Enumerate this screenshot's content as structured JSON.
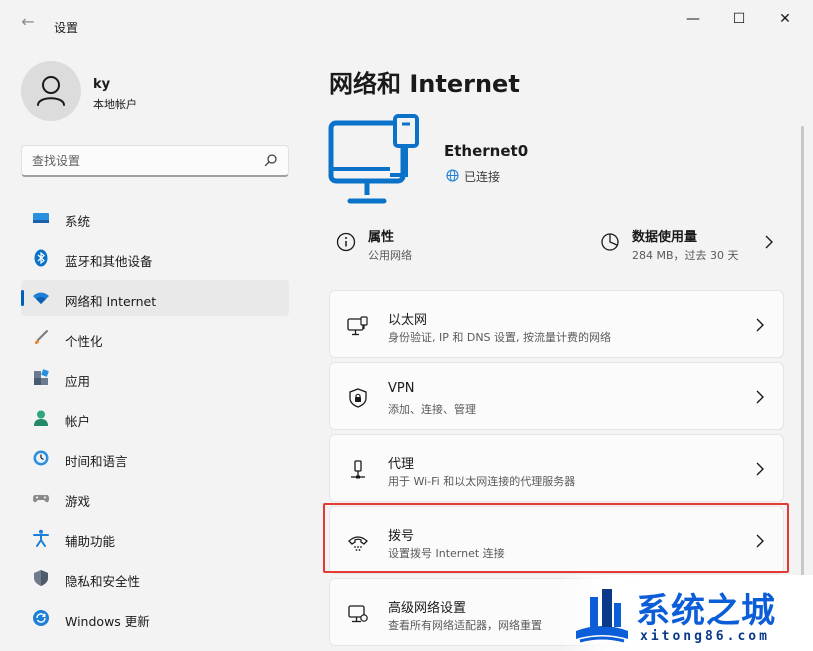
{
  "window": {
    "title": "设置",
    "back_glyph": "←",
    "minimize_glyph": "—",
    "maximize_glyph": "☐",
    "close_glyph": "✕"
  },
  "user": {
    "name": "ky",
    "account_type": "本地帐户"
  },
  "search": {
    "placeholder": "查找设置"
  },
  "sidebar": {
    "items": [
      {
        "label": "系统",
        "icon": "display-icon"
      },
      {
        "label": "蓝牙和其他设备",
        "icon": "bluetooth-icon"
      },
      {
        "label": "网络和 Internet",
        "icon": "wifi-icon",
        "active": true
      },
      {
        "label": "个性化",
        "icon": "brush-icon"
      },
      {
        "label": "应用",
        "icon": "apps-icon"
      },
      {
        "label": "帐户",
        "icon": "person-icon"
      },
      {
        "label": "时间和语言",
        "icon": "clock-globe-icon"
      },
      {
        "label": "游戏",
        "icon": "gamepad-icon"
      },
      {
        "label": "辅助功能",
        "icon": "accessibility-icon"
      },
      {
        "label": "隐私和安全性",
        "icon": "shield-icon"
      },
      {
        "label": "Windows 更新",
        "icon": "update-icon"
      }
    ]
  },
  "main": {
    "title": "网络和 Internet",
    "adapter": {
      "name": "Ethernet0",
      "status": "已连接"
    },
    "properties": {
      "title": "属性",
      "subtitle": "公用网络"
    },
    "data_usage": {
      "title": "数据使用量",
      "subtitle": "284 MB，过去 30 天"
    },
    "cards": [
      {
        "title": "以太网",
        "subtitle": "身份验证, IP 和 DNS 设置, 按流量计费的网络",
        "icon": "ethernet-icon"
      },
      {
        "title": "VPN",
        "subtitle": "添加、连接、管理",
        "icon": "vpn-shield-icon"
      },
      {
        "title": "代理",
        "subtitle": "用于 Wi-Fi 和以太网连接的代理服务器",
        "icon": "proxy-icon"
      },
      {
        "title": "拨号",
        "subtitle": "设置拨号 Internet 连接",
        "icon": "dialup-icon"
      },
      {
        "title": "高级网络设置",
        "subtitle": "查看所有网络适配器，网络重置",
        "icon": "advanced-network-icon"
      }
    ]
  },
  "watermark": {
    "brand": "系统之城",
    "url": "xitong86.com"
  },
  "colors": {
    "accent": "#005fb8",
    "highlight_border": "#e53935",
    "icon_blue": "#0a73c9"
  }
}
